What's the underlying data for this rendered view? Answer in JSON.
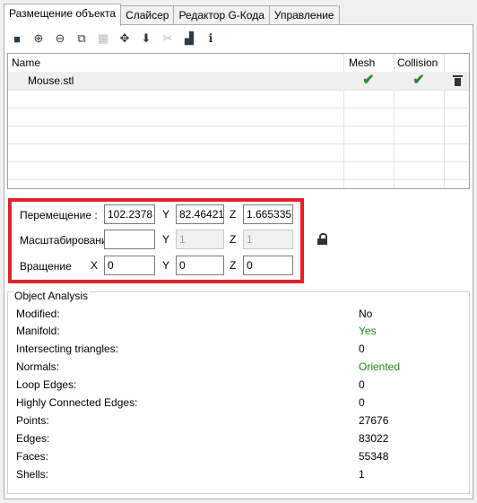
{
  "tabs": [
    {
      "label": "Размещение объекта",
      "active": true
    },
    {
      "label": "Слайсер",
      "active": false
    },
    {
      "label": "Редактор G-Кода",
      "active": false
    },
    {
      "label": "Управление",
      "active": false
    }
  ],
  "toolbar": [
    {
      "icon": "save-icon",
      "glyph": "■",
      "enabled": true
    },
    {
      "icon": "add-icon",
      "glyph": "⊕",
      "enabled": true
    },
    {
      "icon": "remove-icon",
      "glyph": "⊖",
      "enabled": true
    },
    {
      "icon": "copy-icon",
      "glyph": "⧉",
      "enabled": true
    },
    {
      "icon": "grid-icon",
      "glyph": "▦",
      "enabled": false
    },
    {
      "icon": "center-icon",
      "glyph": "✥",
      "enabled": true
    },
    {
      "icon": "drop-icon",
      "glyph": "⬇",
      "enabled": true
    },
    {
      "icon": "cut-icon",
      "glyph": "✂",
      "enabled": false
    },
    {
      "icon": "land-icon",
      "glyph": "▟",
      "enabled": true
    },
    {
      "icon": "info-icon",
      "glyph": "ℹ",
      "enabled": true
    }
  ],
  "grid": {
    "headers": {
      "name": "Name",
      "mesh": "Mesh",
      "collision": "Collision"
    },
    "rows": [
      {
        "name": "Mouse.stl",
        "mesh": "✔",
        "collision": "✔"
      }
    ]
  },
  "transform": {
    "move_label": "Перемещение :",
    "scale_label": "Масштабирование",
    "rotate_label": "Вращение",
    "x_label": "X",
    "y_label": "Y",
    "z_label": "Z",
    "move": {
      "x": "102.2378",
      "y": "82.46421",
      "z": "1.665335"
    },
    "scale": {
      "x": "",
      "y": "1",
      "z": "1"
    },
    "rotate": {
      "x": "0",
      "y": "0",
      "z": "0"
    }
  },
  "analysis": {
    "title": "Object Analysis",
    "rows": [
      {
        "key": "Modified:",
        "value": "No",
        "color": "#000000"
      },
      {
        "key": "Manifold:",
        "value": "Yes",
        "color": "#1b8a1b"
      },
      {
        "key": "Intersecting triangles:",
        "value": "0",
        "color": "#000000"
      },
      {
        "key": "Normals:",
        "value": "Oriented",
        "color": "#1b8a1b"
      },
      {
        "key": "Loop Edges:",
        "value": "0",
        "color": "#000000"
      },
      {
        "key": "Highly Connected Edges:",
        "value": "0",
        "color": "#000000"
      },
      {
        "key": "Points:",
        "value": "27676",
        "color": "#000000"
      },
      {
        "key": "Edges:",
        "value": "83022",
        "color": "#000000"
      },
      {
        "key": "Faces:",
        "value": "55348",
        "color": "#000000"
      },
      {
        "key": "Shells:",
        "value": "1",
        "color": "#000000"
      }
    ]
  }
}
